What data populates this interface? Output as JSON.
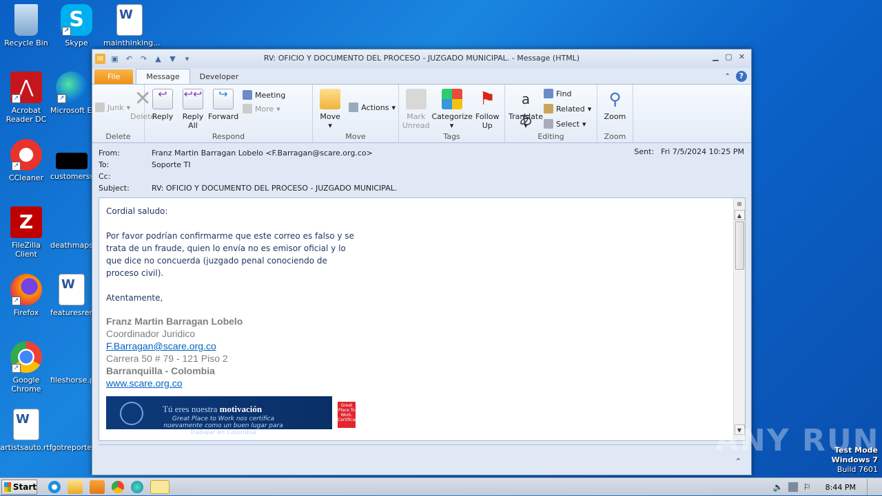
{
  "desktop": {
    "icons": [
      {
        "label": "Recycle Bin",
        "icon": "recycle-bin-icon"
      },
      {
        "label": "Skype",
        "icon": "skype-icon"
      },
      {
        "label": "mainthinking...",
        "icon": "word-doc-icon"
      },
      {
        "label": "Acrobat Reader DC",
        "icon": "acrobat-icon"
      },
      {
        "label": "Microsoft Ed",
        "icon": "edge-icon"
      },
      {
        "label": "CCleaner",
        "icon": "ccleaner-icon"
      },
      {
        "label": "customerss",
        "icon": "black-file-icon"
      },
      {
        "label": "FileZilla Client",
        "icon": "filezilla-icon"
      },
      {
        "label": "deathmaps.",
        "icon": "file-icon"
      },
      {
        "label": "Firefox",
        "icon": "firefox-icon"
      },
      {
        "label": "featuresren",
        "icon": "word-doc-icon"
      },
      {
        "label": "Google Chrome",
        "icon": "chrome-icon"
      },
      {
        "label": "fileshorse.p",
        "icon": "file-icon"
      },
      {
        "label": "artistsauto.rtf",
        "icon": "word-doc-icon"
      },
      {
        "label": "gotreporte",
        "icon": "file-icon"
      }
    ]
  },
  "window": {
    "title": "RV: OFICIO Y DOCUMENTO DEL PROCESO - JUZGADO MUNICIPAL. - Message (HTML)",
    "tabs": [
      "File",
      "Message",
      "Developer"
    ]
  },
  "ribbon": {
    "delete_group": {
      "label": "Delete",
      "junk": "Junk",
      "delete": "Delete"
    },
    "respond_group": {
      "label": "Respond",
      "reply": "Reply",
      "reply_all": "Reply All",
      "forward": "Forward",
      "meeting": "Meeting",
      "more": "More"
    },
    "move_group": {
      "label": "Move",
      "move": "Move",
      "actions": "Actions"
    },
    "tags_group": {
      "label": "Tags",
      "mark_unread": "Mark Unread",
      "categorize": "Categorize",
      "follow_up": "Follow Up"
    },
    "editing_group": {
      "label": "Editing",
      "translate": "Translate",
      "find": "Find",
      "related": "Related",
      "select": "Select"
    },
    "zoom_group": {
      "label": "Zoom",
      "zoom": "Zoom"
    }
  },
  "message": {
    "from_label": "From:",
    "from": "Franz Martin Barragan Lobelo <F.Barragan@scare.org.co>",
    "to_label": "To:",
    "to": "Soporte TI",
    "cc_label": "Cc:",
    "cc": "",
    "subject_label": "Subject:",
    "subject": "RV: OFICIO Y DOCUMENTO DEL PROCESO - JUZGADO MUNICIPAL.",
    "sent_label": "Sent:",
    "sent": "Fri 7/5/2024 10:25 PM",
    "greeting": "Cordial saludo:",
    "para1_line1": "Por favor podrían confirmarme que este correo es falso y se",
    "para1_line2": "trata de un fraude, quien lo envía no es emisor oficial y lo",
    "para1_line3": "que dice no concuerda (juzgado penal conociendo de",
    "para1_line4": "proceso civil).",
    "closing": "Atentamente,",
    "sig_name": "Franz Martin Barragan Lobelo",
    "sig_title": "Coordinador Juridico",
    "sig_email": "F.Barragan@scare.org.co",
    "sig_address": "Carrera 50 # 79 - 121 Piso 2",
    "sig_city": "Barranquilla - Colombia",
    "sig_web": "www.scare.org.co",
    "banner_line1a": "Tú eres nuestra ",
    "banner_line1b": "motivación",
    "banner_line2": "Great Place to Work nos certifica nuevamente como un buen lugar para trabajar en Colombia",
    "gptw": "Great Place To Work. Certificado"
  },
  "watermark": "ANY RUN",
  "os": {
    "test_mode": "Test Mode",
    "windows": "Windows 7",
    "build": "Build 7601"
  },
  "taskbar": {
    "start": "Start",
    "clock": "8:44 PM"
  }
}
